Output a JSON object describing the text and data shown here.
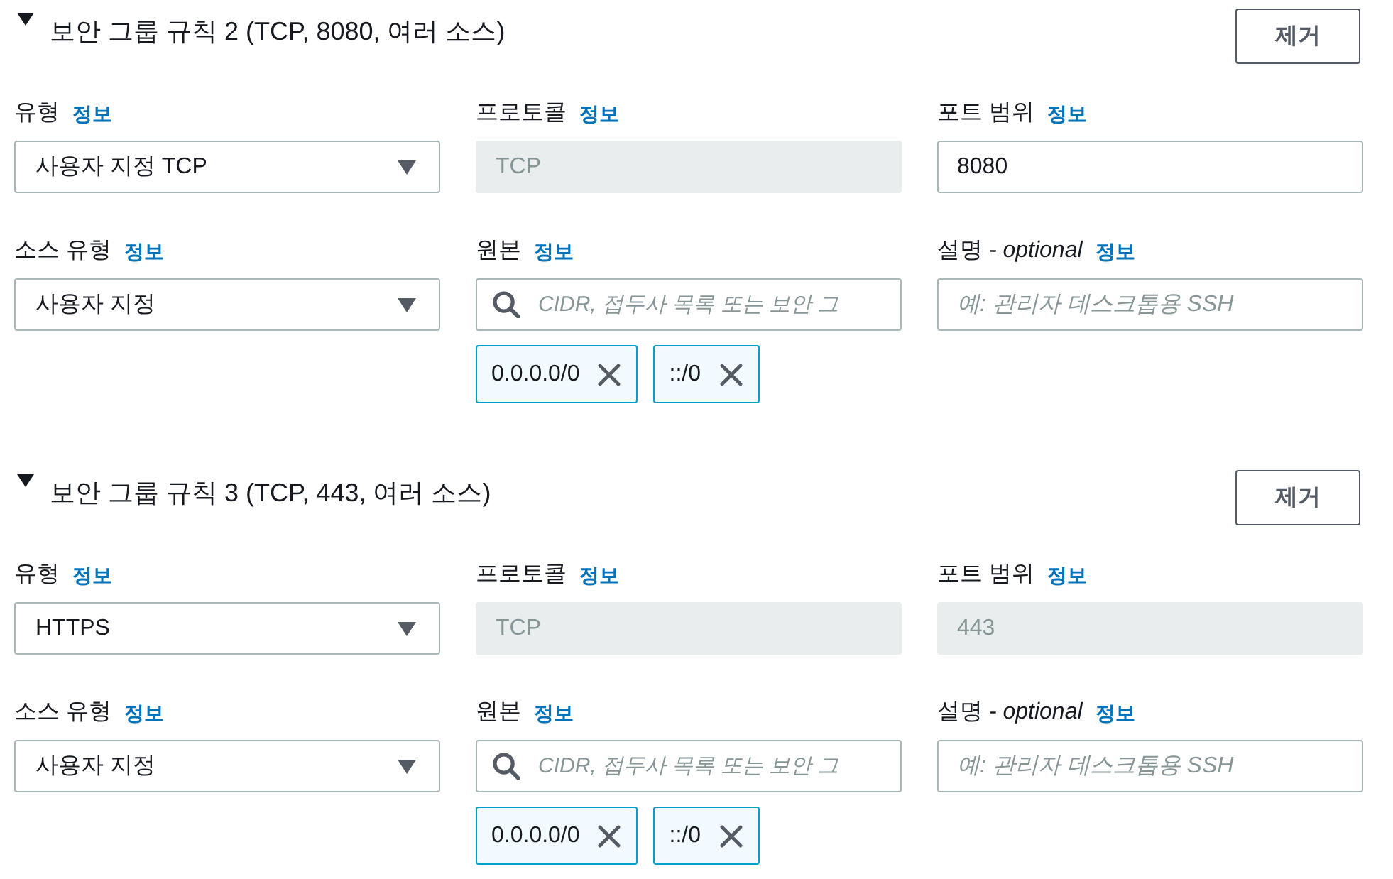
{
  "rules": [
    {
      "title": "보안 그룹 규칙 2 (TCP, 8080, 여러 소스)",
      "expanded": true,
      "remove_button": "제거",
      "fields": [
        {
          "kind": "select",
          "label": "유형",
          "info_link": "정보",
          "value": "사용자 지정 TCP"
        },
        {
          "kind": "text",
          "label": "프로토콜",
          "info_link": "정보",
          "value": "TCP",
          "disabled": true
        },
        {
          "kind": "text",
          "label": "포트 범위",
          "info_link": "정보",
          "value": "8080",
          "disabled": false
        },
        {
          "kind": "select",
          "label": "소스 유형",
          "info_link": "정보",
          "value": "사용자 지정"
        },
        {
          "kind": "search",
          "label": "원본",
          "info_link": "정보",
          "placeholder": "CIDR, 접두사 목록 또는 보안 그",
          "tokens": [
            "0.0.0.0/0",
            "::/0"
          ]
        },
        {
          "kind": "text",
          "label": "설명 *- optional*",
          "info_link": "정보",
          "placeholder": "예: 관리자 데스크톱용 SSH",
          "disabled": false
        }
      ]
    },
    {
      "title": "보안 그룹 규칙 3 (TCP, 443, 여러 소스)",
      "expanded": true,
      "remove_button": "제거",
      "fields": [
        {
          "kind": "select",
          "label": "유형",
          "info_link": "정보",
          "value": "HTTPS"
        },
        {
          "kind": "text",
          "label": "프로토콜",
          "info_link": "정보",
          "value": "TCP",
          "disabled": true
        },
        {
          "kind": "text",
          "label": "포트 범위",
          "info_link": "정보",
          "value": "443",
          "disabled": true
        },
        {
          "kind": "select",
          "label": "소스 유형",
          "info_link": "정보",
          "value": "사용자 지정"
        },
        {
          "kind": "search",
          "label": "원본",
          "info_link": "정보",
          "placeholder": "CIDR, 접두사 목록 또는 보안 그",
          "tokens": [
            "0.0.0.0/0",
            "::/0"
          ]
        },
        {
          "kind": "text",
          "label": "설명 *- optional*",
          "info_link": "정보",
          "placeholder": "예: 관리자 데스크톱용 SSH",
          "disabled": false
        }
      ]
    }
  ]
}
